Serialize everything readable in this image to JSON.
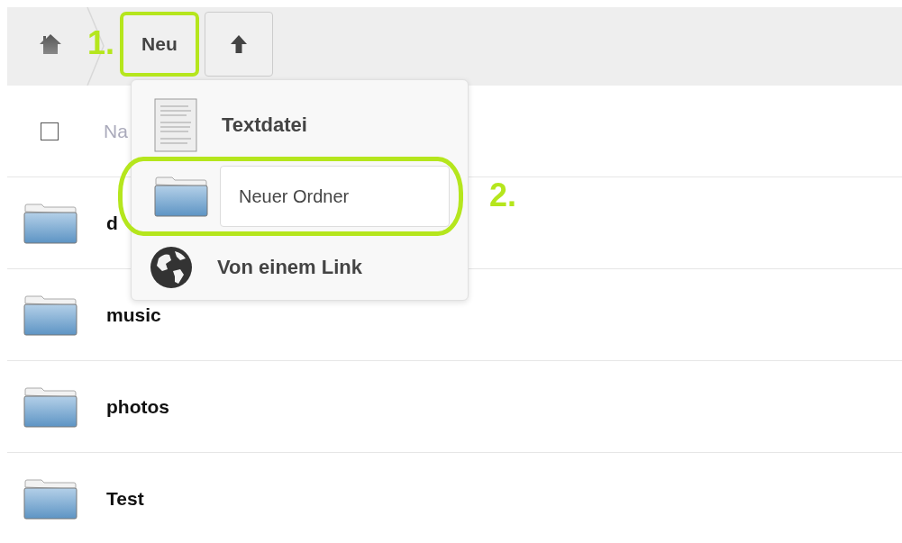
{
  "toolbar": {
    "step_label": "1.",
    "buttons": [
      {
        "kind": "text",
        "label": "Neu",
        "highlighted": true
      },
      {
        "kind": "upload",
        "highlighted": false
      }
    ]
  },
  "new_menu": {
    "items": [
      {
        "kind": "file",
        "label": "Textdatei",
        "highlighted": false
      },
      {
        "kind": "folder-input",
        "value": "Neuer Ordner",
        "highlighted": true,
        "step_label": "2."
      },
      {
        "kind": "link",
        "label": "Von einem Link",
        "highlighted": false
      }
    ]
  },
  "file_list": {
    "header": {
      "checked": false,
      "column_1": "Na"
    },
    "rows": [
      {
        "name": "d"
      },
      {
        "name": "music"
      },
      {
        "name": "photos"
      },
      {
        "name": "Test"
      }
    ]
  }
}
